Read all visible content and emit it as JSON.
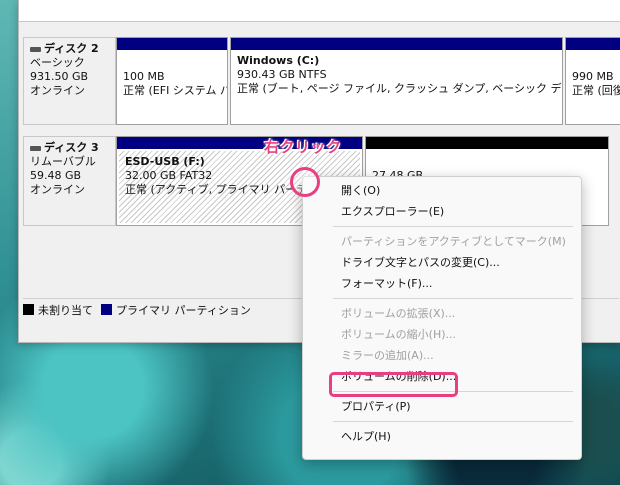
{
  "disks": [
    {
      "name": "ディスク 2",
      "type": "ベーシック",
      "size": "931.50 GB",
      "status": "オンライン",
      "partitions": [
        {
          "title": "",
          "size": "100 MB",
          "status": "正常 (EFI システム パ"
        },
        {
          "title": "Windows  (C:)",
          "size": "930.43 GB NTFS",
          "status": "正常 (ブート, ページ ファイル, クラッシュ ダンプ, ベーシック データ パーティ"
        },
        {
          "title": "",
          "size": "990 MB",
          "status": "正常 (回復"
        }
      ]
    },
    {
      "name": "ディスク 3",
      "type": "リムーバブル",
      "size": "59.48 GB",
      "status": "オンライン",
      "partitions": [
        {
          "title": "ESD-USB  (F:)",
          "size": "32.00 GB FAT32",
          "status": "正常 (アクティブ, プライマリ パーティション"
        },
        {
          "title": "",
          "size": "27.48 GB",
          "status": ""
        }
      ]
    }
  ],
  "legend": {
    "unallocated": "未割り当て",
    "primary": "プライマリ パーティション",
    "unallocated_color": "#000000",
    "primary_color": "#000080"
  },
  "context_menu": {
    "items": [
      {
        "label": "開く(O)",
        "enabled": true
      },
      {
        "label": "エクスプローラー(E)",
        "enabled": true
      },
      {
        "label": "パーティションをアクティブとしてマーク(M)",
        "enabled": false
      },
      {
        "label": "ドライブ文字とパスの変更(C)...",
        "enabled": true
      },
      {
        "label": "フォーマット(F)...",
        "enabled": true
      },
      {
        "label": "ボリュームの拡張(X)...",
        "enabled": false
      },
      {
        "label": "ボリュームの縮小(H)...",
        "enabled": false
      },
      {
        "label": "ミラーの追加(A)...",
        "enabled": false
      },
      {
        "label": "ボリュームの削除(D)...",
        "enabled": true
      },
      {
        "label": "プロパティ(P)",
        "enabled": true
      },
      {
        "label": "ヘルプ(H)",
        "enabled": true
      }
    ]
  },
  "annotation": {
    "label": "右クリック",
    "accent_color": "#e83f80"
  }
}
